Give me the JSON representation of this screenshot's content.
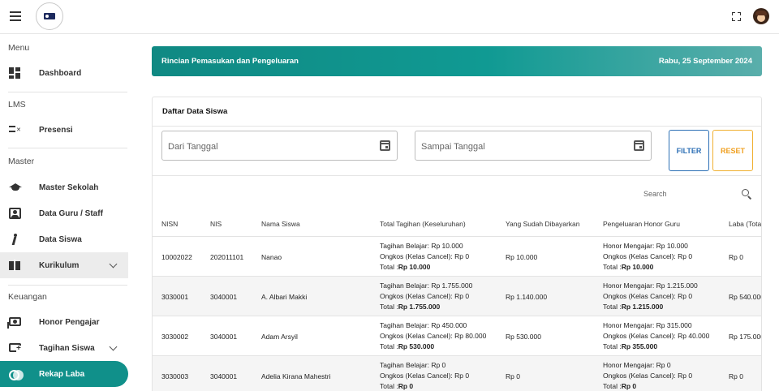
{
  "colors": {
    "brand": "#10908a",
    "filter": "#2c6fb5",
    "reset": "#f0a020"
  },
  "sidebar": {
    "sections": [
      {
        "title": "Menu",
        "items": [
          {
            "label": "Dashboard",
            "icon": "dashboard-icon"
          }
        ]
      },
      {
        "title": "LMS",
        "items": [
          {
            "label": "Presensi",
            "icon": "checklist-icon"
          }
        ]
      },
      {
        "title": "Master",
        "items": [
          {
            "label": "Master Sekolah",
            "icon": "graduation-cap-icon"
          },
          {
            "label": "Data Guru / Staff",
            "icon": "contact-card-icon"
          },
          {
            "label": "Data Siswa",
            "icon": "walking-person-icon"
          },
          {
            "label": "Kurikulum",
            "icon": "book-icon",
            "expandable": true
          }
        ]
      },
      {
        "title": "Keuangan",
        "items": [
          {
            "label": "Honor Pengajar",
            "icon": "money-icon"
          },
          {
            "label": "Tagihan Siswa",
            "icon": "add-bill-icon",
            "expandable": true
          },
          {
            "label": "Rekap Laba",
            "icon": "coins-icon",
            "active": true
          }
        ]
      }
    ]
  },
  "banner": {
    "title": "Rincian Pemasukan dan Pengeluaran",
    "date": "Rabu, 25 September 2024"
  },
  "card": {
    "title": "Daftar Data Siswa",
    "from_placeholder": "Dari Tanggal",
    "to_placeholder": "Sampai Tanggal",
    "filter_label": "FILTER",
    "reset_label": "RESET",
    "search_label": "Search"
  },
  "table": {
    "columns": [
      "NISN",
      "NIS",
      "Nama Siswa",
      "Total Tagihan (Keseluruhan)",
      "Yang Sudah Dibayarkan",
      "Pengeluaran Honor Guru",
      "Laba (Total"
    ],
    "rows": [
      {
        "nisn": "10002022",
        "nis": "202011101",
        "nama": "Nanao",
        "tagihan": {
          "belajar": "Tagihan Belajar: Rp 10.000",
          "ongkos": "Ongkos (Kelas Cancel): Rp 0",
          "total_prefix": "Total :",
          "total": "Rp 10.000"
        },
        "dibayar": "Rp 10.000",
        "honor": {
          "mengajar": "Honor Mengajar: Rp 10.000",
          "ongkos": "Ongkos (Kelas Cancel): Rp 0",
          "total_prefix": "Total :",
          "total": "Rp 10.000"
        },
        "laba": "Rp 0"
      },
      {
        "nisn": "3030001",
        "nis": "3040001",
        "nama": "A. Albari Makki",
        "tagihan": {
          "belajar": "Tagihan Belajar: Rp 1.755.000",
          "ongkos": "Ongkos (Kelas Cancel): Rp 0",
          "total_prefix": "Total :",
          "total": "Rp 1.755.000"
        },
        "dibayar": "Rp 1.140.000",
        "honor": {
          "mengajar": "Honor Mengajar: Rp 1.215.000",
          "ongkos": "Ongkos (Kelas Cancel): Rp 0",
          "total_prefix": "Total :",
          "total": "Rp 1.215.000"
        },
        "laba": "Rp 540.000"
      },
      {
        "nisn": "3030002",
        "nis": "3040001",
        "nama": "Adam Arsyil",
        "tagihan": {
          "belajar": "Tagihan Belajar: Rp 450.000",
          "ongkos": "Ongkos (Kelas Cancel): Rp 80.000",
          "total_prefix": "Total :",
          "total": "Rp 530.000"
        },
        "dibayar": "Rp 530.000",
        "honor": {
          "mengajar": "Honor Mengajar: Rp 315.000",
          "ongkos": "Ongkos (Kelas Cancel): Rp 40.000",
          "total_prefix": "Total :",
          "total": "Rp 355.000"
        },
        "laba": "Rp 175.000"
      },
      {
        "nisn": "3030003",
        "nis": "3040001",
        "nama": "Adelia Kirana Mahestri",
        "tagihan": {
          "belajar": "Tagihan Belajar: Rp 0",
          "ongkos": "Ongkos (Kelas Cancel): Rp 0",
          "total_prefix": "Total :",
          "total": "Rp 0"
        },
        "dibayar": "Rp 0",
        "honor": {
          "mengajar": "Honor Mengajar: Rp 0",
          "ongkos": "Ongkos (Kelas Cancel): Rp 0",
          "total_prefix": "Total :",
          "total": "Rp 0"
        },
        "laba": "Rp 0"
      }
    ]
  }
}
